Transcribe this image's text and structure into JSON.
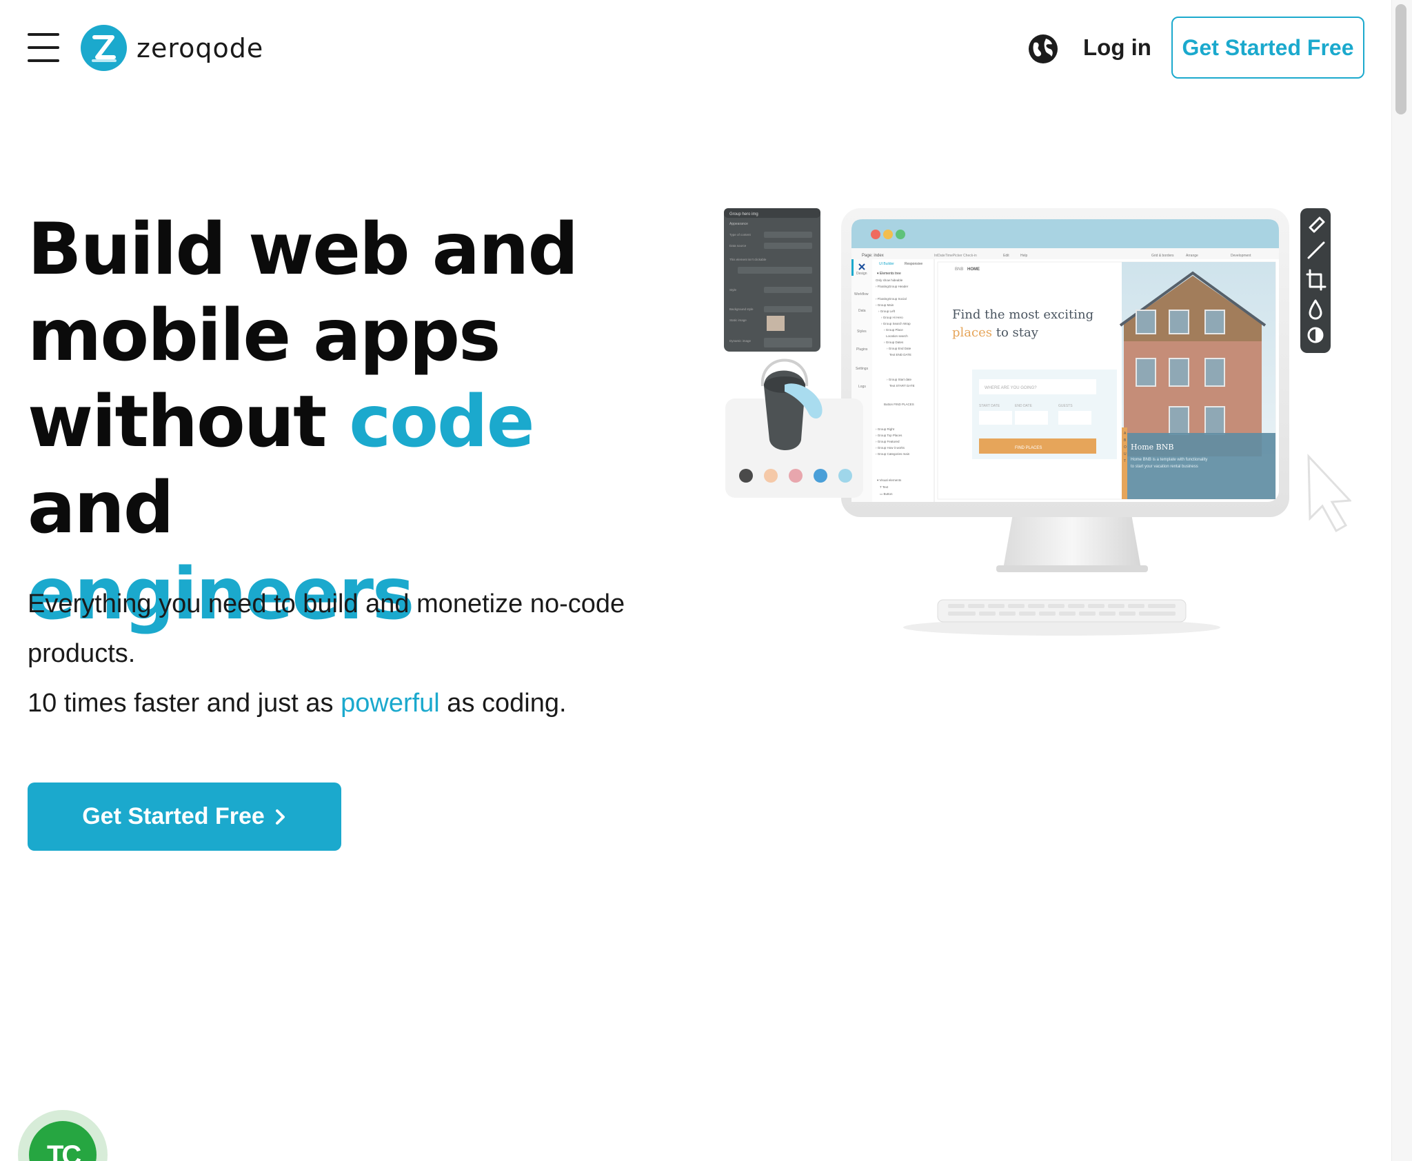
{
  "header": {
    "logo_text": "zeroqode",
    "login_label": "Log in",
    "cta_label": "Get Started Free",
    "icons": [
      "menu-icon",
      "logo-icon",
      "globe-icon"
    ]
  },
  "hero": {
    "title_1": "Build web and",
    "title_2": "mobile apps",
    "title_3a": "without ",
    "title_3b": "code",
    "title_3c": " and",
    "title_4": "engineers",
    "sub_1": "Everything you need to build and monetize no-code products.",
    "sub_2a": "10 times faster and just as ",
    "sub_2b": "powerful",
    "sub_2c": " as coding.",
    "cta_label": "Get Started Free",
    "cta_icon": "chevron-right-icon"
  },
  "illustration": {
    "editor_page": "Page: index",
    "editor_tab_ui": "UI Builder",
    "editor_tab_responsive": "Responsive",
    "editor_menu": [
      "Edit",
      "Help",
      "Grid & borders",
      "Arrange",
      "Development"
    ],
    "sidebar_items": [
      "Design",
      "Workflow",
      "Data",
      "Styles",
      "Plugins",
      "Settings",
      "Logs"
    ],
    "tree_header": "Elements tree",
    "tree_items": [
      "Only show hideable",
      "FloatingGroup Header",
      "FloatingGroup Social",
      "Group Main",
      "Group Left",
      "Group Hi Hero",
      "Group Search Wrap",
      "Group Place",
      "Location search",
      "Group Dates",
      "Group End Date",
      "Text END DATE",
      "Group Start date",
      "Text START DATE",
      "Button FIND PLACES",
      "Group Right",
      "Group Top Places",
      "Group Featured",
      "Group How it works",
      "Group Categories main",
      "Visual elements",
      "Text",
      "Button"
    ],
    "site_brand": "HOME",
    "site_headline_a": "Find the most exciting",
    "site_headline_b": "places",
    "site_headline_c": " to stay",
    "search_placeholder": "WHERE ARE YOU GOING?",
    "field_labels": [
      "START DATE",
      "END DATE",
      "GUESTS"
    ],
    "find_button": "FIND PLACES",
    "card_title": "Home BNB",
    "card_text": "Home BNB is a template with functionality to start your vacation rental business",
    "about_letters": "ABOUT",
    "panel_title": "Group hero img",
    "panel_tab": "Appearance",
    "panel_rows": [
      "Type of content",
      "Data source",
      "This element isn't clickable",
      "Start/Edit workflow",
      "Style",
      "Background style",
      "Static image",
      "Dynamic image"
    ],
    "panel_values": [
      "Image",
      "//s3.amazonaws.com/appforest_uf/f15707...png"
    ],
    "swatch_colors": [
      "#4a4a4a",
      "#f5c9a8",
      "#e8a6ad",
      "#4a9fd8",
      "#9fd6ea"
    ],
    "tool_icons": [
      "pen-icon",
      "brush-icon",
      "crop-icon",
      "drop-icon",
      "contrast-icon"
    ],
    "accent": "#1ba9cd",
    "orange": "#e6a55a"
  },
  "badge": {
    "letters": "TC",
    "icon": "partner-badge-icon"
  },
  "colors": {
    "brand": "#1ba9cd",
    "text": "#0b0b0b",
    "badge_green": "#26a641"
  }
}
